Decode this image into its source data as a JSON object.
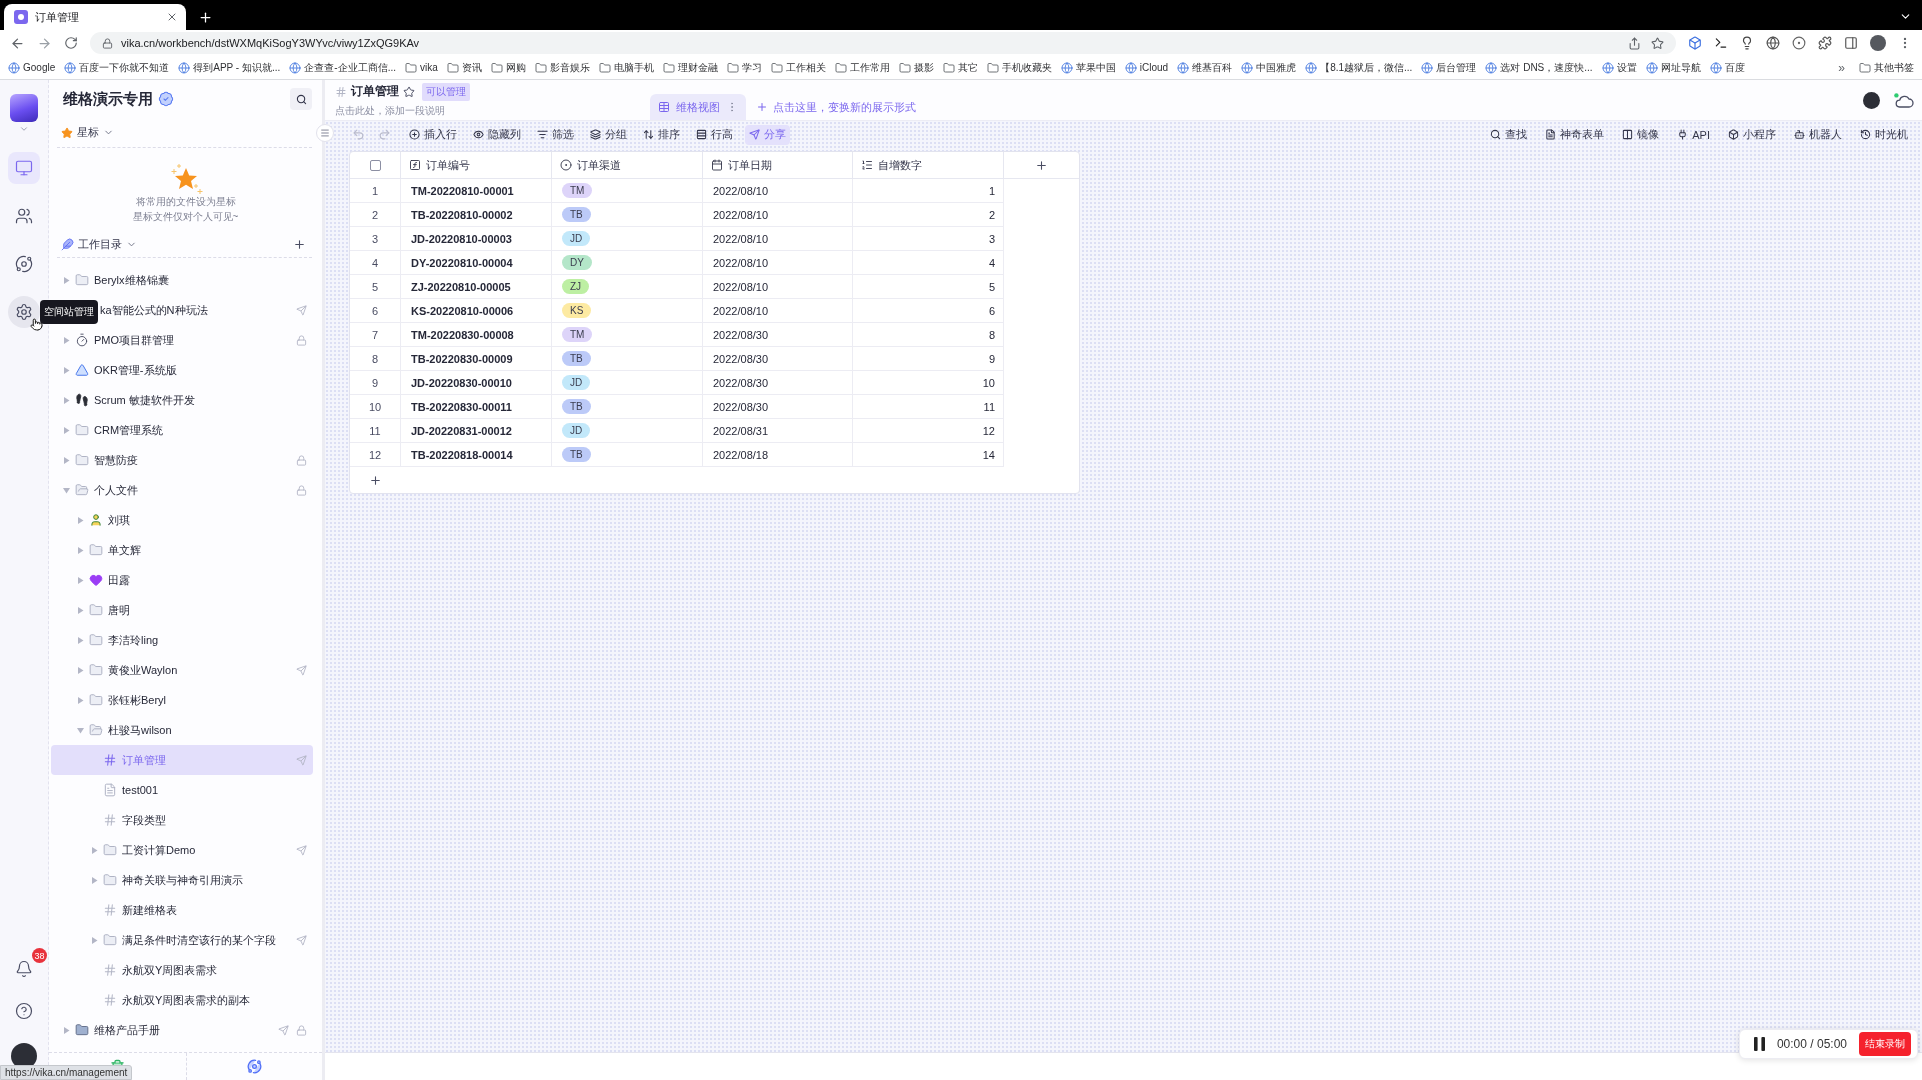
{
  "browser": {
    "tab_title": "订单管理",
    "url": "vika.cn/workbench/dstWXMqKiSogY3WYvc/viwy1ZxQG9KAv",
    "bookmarks": [
      {
        "label": "Google",
        "kind": "site"
      },
      {
        "label": "百度一下你就不知道",
        "kind": "site"
      },
      {
        "label": "得到APP - 知识就...",
        "kind": "site"
      },
      {
        "label": "企查查-企业工商信...",
        "kind": "site"
      },
      {
        "label": "vika",
        "kind": "folder"
      },
      {
        "label": "资讯",
        "kind": "folder"
      },
      {
        "label": "网购",
        "kind": "folder"
      },
      {
        "label": "影音娱乐",
        "kind": "folder"
      },
      {
        "label": "电脑手机",
        "kind": "folder"
      },
      {
        "label": "理财金融",
        "kind": "folder"
      },
      {
        "label": "学习",
        "kind": "folder"
      },
      {
        "label": "工作相关",
        "kind": "folder"
      },
      {
        "label": "工作常用",
        "kind": "folder"
      },
      {
        "label": "摄影",
        "kind": "folder"
      },
      {
        "label": "其它",
        "kind": "folder"
      },
      {
        "label": "手机收藏夹",
        "kind": "folder"
      },
      {
        "label": "苹果中国",
        "kind": "site"
      },
      {
        "label": "iCloud",
        "kind": "site"
      },
      {
        "label": "维基百科",
        "kind": "site"
      },
      {
        "label": "中国雅虎",
        "kind": "site"
      },
      {
        "label": "【8.1越狱后，微信...",
        "kind": "site"
      },
      {
        "label": "后台管理",
        "kind": "site"
      },
      {
        "label": "选对 DNS，速度快...",
        "kind": "site"
      },
      {
        "label": "设置",
        "kind": "site"
      },
      {
        "label": "网址导航",
        "kind": "site"
      },
      {
        "label": "百度",
        "kind": "site"
      }
    ],
    "overflow": "»",
    "other_bookmarks": "其他书签",
    "status_url": "https://vika.cn/management"
  },
  "rail": {
    "items": [
      {
        "kind": "workbench",
        "selected": true,
        "hovered": false
      },
      {
        "kind": "members",
        "selected": false,
        "hovered": false
      },
      {
        "kind": "explore",
        "selected": false,
        "hovered": false
      },
      {
        "kind": "admin",
        "selected": false,
        "hovered": true
      }
    ],
    "tooltip": "空间站管理",
    "notification_count": "38"
  },
  "sidebar": {
    "space_name": "维格演示专用",
    "starred": {
      "label": "星标",
      "empty_text": [
        "将常用的文件设为星标",
        "星标文件仅对个人可见~"
      ]
    },
    "catalog": {
      "label": "工作目录"
    },
    "tree": [
      {
        "label": "Berylx维格锦囊",
        "kind": "folder",
        "expanded": false,
        "selected": false,
        "shared": false,
        "locked": false
      },
      {
        "label": "ka智能公式的N种玩法",
        "kind": "covered",
        "expanded": false,
        "selected": false,
        "shared": true,
        "locked": false
      },
      {
        "label": "PMO项目群管理",
        "kind": "timer",
        "expanded": false,
        "selected": false,
        "shared": false,
        "locked": true
      },
      {
        "label": "OKR管理-系统版",
        "kind": "ruler",
        "expanded": false,
        "selected": false,
        "shared": false,
        "locked": false
      },
      {
        "label": "Scrum 敏捷软件开发",
        "kind": "footprints",
        "expanded": false,
        "selected": false,
        "shared": false,
        "locked": false
      },
      {
        "label": "CRM管理系统",
        "kind": "folder",
        "expanded": false,
        "selected": false,
        "shared": false,
        "locked": false
      },
      {
        "label": "智慧防疫",
        "kind": "folder",
        "expanded": false,
        "selected": false,
        "shared": false,
        "locked": true
      },
      {
        "label": "个人文件",
        "kind": "folder",
        "expanded": true,
        "selected": false,
        "shared": false,
        "locked": true,
        "children": [
          {
            "label": "刘琪",
            "kind": "person",
            "expanded": false,
            "selected": false,
            "shared": false,
            "locked": false
          },
          {
            "label": "单文辉",
            "kind": "folder",
            "expanded": false,
            "selected": false,
            "shared": false,
            "locked": false
          },
          {
            "label": "田露",
            "kind": "heart",
            "expanded": false,
            "selected": false,
            "shared": false,
            "locked": false
          },
          {
            "label": "唐明",
            "kind": "folder",
            "expanded": false,
            "selected": false,
            "shared": false,
            "locked": false
          },
          {
            "label": "李洁玲ling",
            "kind": "folder",
            "expanded": false,
            "selected": false,
            "shared": false,
            "locked": false
          },
          {
            "label": "黄俊业Waylon",
            "kind": "folder",
            "expanded": false,
            "selected": false,
            "shared": true,
            "locked": false
          },
          {
            "label": "张钰彬Beryl",
            "kind": "folder",
            "expanded": false,
            "selected": false,
            "shared": false,
            "locked": false
          },
          {
            "label": "杜骏马wilson",
            "kind": "folder",
            "expanded": true,
            "selected": false,
            "shared": false,
            "locked": false,
            "children": [
              {
                "label": "订单管理",
                "kind": "sheet",
                "expanded": false,
                "selected": true,
                "shared": true,
                "locked": false
              },
              {
                "label": "test001",
                "kind": "doc",
                "expanded": false,
                "selected": false,
                "shared": false,
                "locked": false
              },
              {
                "label": "字段类型",
                "kind": "sheet",
                "expanded": false,
                "selected": false,
                "shared": false,
                "locked": false
              },
              {
                "label": "工资计算Demo",
                "kind": "folder",
                "expanded": false,
                "selected": false,
                "shared": true,
                "locked": false
              },
              {
                "label": "神奇关联与神奇引用演示",
                "kind": "folder",
                "expanded": false,
                "selected": false,
                "shared": false,
                "locked": false
              },
              {
                "label": "新建维格表",
                "kind": "sheet",
                "expanded": false,
                "selected": false,
                "shared": false,
                "locked": false
              },
              {
                "label": "满足条件时清空该行的某个字段",
                "kind": "folder",
                "expanded": false,
                "selected": false,
                "shared": true,
                "locked": false
              },
              {
                "label": "永航双Y周图表需求",
                "kind": "sheet",
                "expanded": false,
                "selected": false,
                "shared": false,
                "locked": false
              },
              {
                "label": "永航双Y周图表需求的副本",
                "kind": "sheet",
                "expanded": false,
                "selected": false,
                "shared": false,
                "locked": false
              }
            ]
          }
        ]
      },
      {
        "label": "维格产品手册",
        "kind": "binder",
        "expanded": false,
        "selected": false,
        "shared": true,
        "locked": true
      }
    ]
  },
  "header": {
    "title": "订单管理",
    "starred": false,
    "permission": "可以管理",
    "description": "点击此处，添加一段说明",
    "views": [
      {
        "label": "维格视图",
        "selected": true
      }
    ],
    "add_view": "点击这里，变换新的展示形式"
  },
  "toolbar": {
    "history": [
      {
        "kind": "undo",
        "disabled": true
      },
      {
        "kind": "redo",
        "disabled": true
      }
    ],
    "tools": [
      {
        "label": "插入行",
        "kind": "insert",
        "selected": false
      },
      {
        "label": "隐藏列",
        "kind": "hide",
        "selected": false
      },
      {
        "label": "筛选",
        "kind": "filter",
        "selected": false
      },
      {
        "label": "分组",
        "kind": "group",
        "selected": false
      },
      {
        "label": "排序",
        "kind": "sort",
        "selected": false
      },
      {
        "label": "行高",
        "kind": "height",
        "selected": false
      },
      {
        "label": "分享",
        "kind": "share",
        "selected": true
      }
    ],
    "tools_right": [
      {
        "label": "查找",
        "kind": "search"
      },
      {
        "label": "神奇表单",
        "kind": "form"
      },
      {
        "label": "镜像",
        "kind": "mirror"
      },
      {
        "label": "API",
        "kind": "api"
      },
      {
        "label": "小程序",
        "kind": "widget"
      },
      {
        "label": "机器人",
        "kind": "robot"
      },
      {
        "label": "时光机",
        "kind": "history"
      }
    ]
  },
  "table": {
    "all_selected": false,
    "columns": [
      {
        "label": "订单编号",
        "kind": "formula"
      },
      {
        "label": "订单渠道",
        "kind": "select"
      },
      {
        "label": "订单日期",
        "kind": "date"
      },
      {
        "label": "自增数字",
        "kind": "autonumber"
      }
    ],
    "rows": [
      {
        "index": "1",
        "order_no": "TM-20220810-00001",
        "channel": {
          "label": "TM",
          "color": "#ddd4f9"
        },
        "date": "2022/08/10",
        "number": "1"
      },
      {
        "index": "2",
        "order_no": "TB-20220810-00002",
        "channel": {
          "label": "TB",
          "color": "#bccaf8"
        },
        "date": "2022/08/10",
        "number": "2"
      },
      {
        "index": "3",
        "order_no": "JD-20220810-00003",
        "channel": {
          "label": "JD",
          "color": "#c2e8fa"
        },
        "date": "2022/08/10",
        "number": "3"
      },
      {
        "index": "4",
        "order_no": "DY-20220810-00004",
        "channel": {
          "label": "DY",
          "color": "#b4e6c9"
        },
        "date": "2022/08/10",
        "number": "4"
      },
      {
        "index": "5",
        "order_no": "ZJ-20220810-00005",
        "channel": {
          "label": "ZJ",
          "color": "#bdefa3"
        },
        "date": "2022/08/10",
        "number": "5"
      },
      {
        "index": "6",
        "order_no": "KS-20220810-00006",
        "channel": {
          "label": "KS",
          "color": "#fdeaa2"
        },
        "date": "2022/08/10",
        "number": "6"
      },
      {
        "index": "7",
        "order_no": "TM-20220830-00008",
        "channel": {
          "label": "TM",
          "color": "#ddd4f9"
        },
        "date": "2022/08/30",
        "number": "8"
      },
      {
        "index": "8",
        "order_no": "TB-20220830-00009",
        "channel": {
          "label": "TB",
          "color": "#bccaf8"
        },
        "date": "2022/08/30",
        "number": "9"
      },
      {
        "index": "9",
        "order_no": "JD-20220830-00010",
        "channel": {
          "label": "JD",
          "color": "#c2e8fa"
        },
        "date": "2022/08/30",
        "number": "10"
      },
      {
        "index": "10",
        "order_no": "TB-20220830-00011",
        "channel": {
          "label": "TB",
          "color": "#bccaf8"
        },
        "date": "2022/08/30",
        "number": "11"
      },
      {
        "index": "11",
        "order_no": "JD-20220831-00012",
        "channel": {
          "label": "JD",
          "color": "#c2e8fa"
        },
        "date": "2022/08/31",
        "number": "12"
      },
      {
        "index": "12",
        "order_no": "TB-20220818-00014",
        "channel": {
          "label": "TB",
          "color": "#bccaf8"
        },
        "date": "2022/08/18",
        "number": "14"
      }
    ]
  },
  "recorder": {
    "time": "00:00 / 05:00",
    "stop": "结束录制"
  }
}
